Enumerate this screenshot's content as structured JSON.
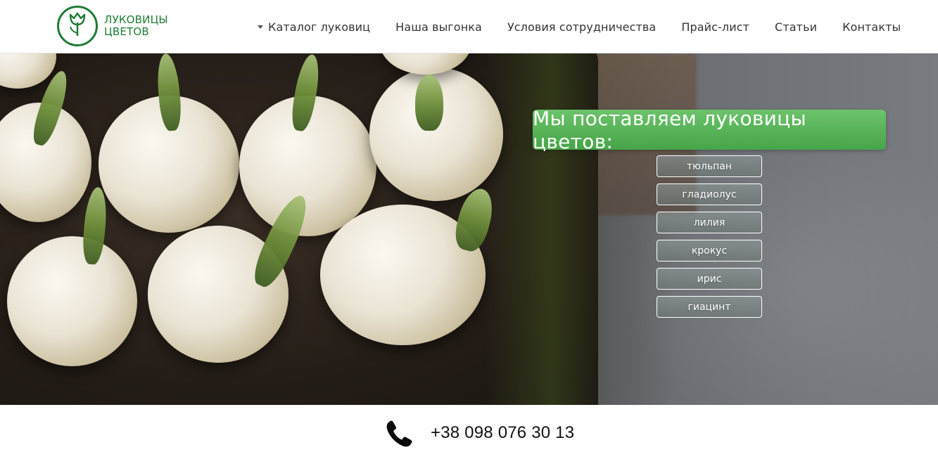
{
  "logo": {
    "line1": "ЛУКОВИЦЫ",
    "line2": "ЦВЕТОВ",
    "icon": "tulip-icon",
    "color": "#1e7b34"
  },
  "nav": {
    "items": [
      {
        "label": "Каталог луковиц",
        "has_dropdown": true
      },
      {
        "label": "Наша выгонка"
      },
      {
        "label": "Условия сотрудничества"
      },
      {
        "label": "Прайс-лист"
      },
      {
        "label": "Статьи"
      },
      {
        "label": "Контакты"
      }
    ]
  },
  "hero": {
    "banner": "Мы поставляем луковицы цветов:",
    "banner_color": "#4caf50",
    "flowers": [
      "тюльпан",
      "гладиолус",
      "лилия",
      "крокус",
      "ирис",
      "гиацинт"
    ]
  },
  "contact": {
    "phone": "+38 098 076 30 13",
    "icon": "phone-icon"
  }
}
